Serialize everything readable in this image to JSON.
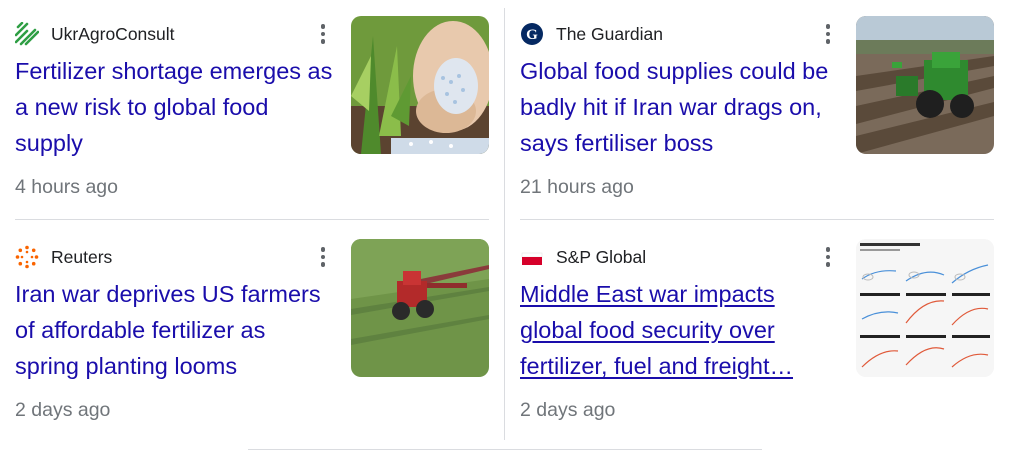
{
  "cards": [
    {
      "source": "UkrAgroConsult",
      "source_icon": "ukragroconsult-logo-icon",
      "headline": "Fertilizer shortage emerges as a new risk to global food supply",
      "time": "4 hours ago",
      "thumbnail": "hand-with-fertilizer-granules-image"
    },
    {
      "source": "The Guardian",
      "source_icon": "guardian-logo-icon",
      "headline": "Global food supplies could be badly hit if Iran war drags on, says fertiliser boss",
      "time": "21 hours ago",
      "thumbnail": "tractor-in-field-image"
    },
    {
      "source": "Reuters",
      "source_icon": "reuters-logo-icon",
      "headline": "Iran war deprives US farmers of affordable fertilizer as spring planting looms",
      "time": "2 days ago",
      "thumbnail": "red-tractor-spraying-field-image"
    },
    {
      "source": "S&P Global",
      "source_icon": "sp-global-logo-icon",
      "headline": "Middle East war impacts global food security over fertilizer, fuel and freight…",
      "time": "2 days ago",
      "thumbnail": "commodities-charts-image"
    }
  ],
  "colors": {
    "headline": "#1a0dab",
    "meta": "#70757a",
    "source": "#202124",
    "divider": "#dadce0"
  }
}
